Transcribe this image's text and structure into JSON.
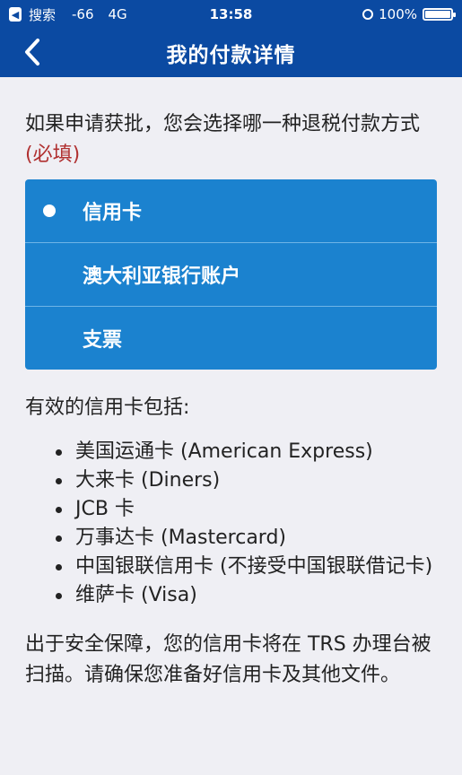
{
  "status_bar": {
    "back_app": "搜索",
    "signal": "-66",
    "network": "4G",
    "time": "13:58",
    "battery": "100%"
  },
  "nav": {
    "title": "我的付款详情"
  },
  "question": {
    "text": "如果申请获批，您会选择哪一种退税付款方式",
    "required": "(必填)"
  },
  "options": [
    {
      "label": "信用卡",
      "selected": true
    },
    {
      "label": "澳大利亚银行账户",
      "selected": false
    },
    {
      "label": "支票",
      "selected": false
    }
  ],
  "cards_intro": "有效的信用卡包括:",
  "cards": [
    "美国运通卡 (American Express)",
    "大来卡 (Diners)",
    "JCB 卡",
    "万事达卡 (Mastercard)",
    "中国银联信用卡 (不接受中国银联借记卡)",
    "维萨卡 (Visa)"
  ],
  "security_note": "出于安全保障，您的信用卡将在 TRS 办理台被扫描。请确保您准备好信用卡及其他文件。",
  "colors": {
    "header": "#0b4aa2",
    "option_bg": "#1b82cf",
    "required": "#b03030"
  }
}
